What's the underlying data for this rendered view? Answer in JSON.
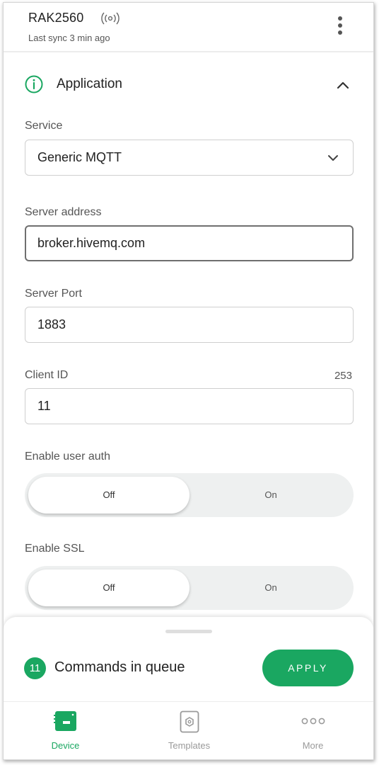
{
  "header": {
    "device_name": "RAK2560",
    "sync_status": "Last sync 3 min ago"
  },
  "section": {
    "title": "Application",
    "expanded": true
  },
  "fields": {
    "service": {
      "label": "Service",
      "value": "Generic MQTT"
    },
    "server_address": {
      "label": "Server address",
      "value": "broker.hivemq.com"
    },
    "server_port": {
      "label": "Server Port",
      "value": "1883"
    },
    "client_id": {
      "label": "Client ID",
      "value": "11",
      "counter": "253"
    }
  },
  "toggles": {
    "user_auth": {
      "label": "Enable user auth",
      "off_label": "Off",
      "on_label": "On",
      "selected": "Off"
    },
    "ssl": {
      "label": "Enable SSL",
      "off_label": "Off",
      "on_label": "On",
      "selected": "Off"
    }
  },
  "queue": {
    "count": "11",
    "text": "Commands in queue",
    "apply_label": "APPLY"
  },
  "nav": {
    "items": [
      {
        "label": "Device",
        "icon": "device-icon",
        "active": true
      },
      {
        "label": "Templates",
        "icon": "templates-icon",
        "active": false
      },
      {
        "label": "More",
        "icon": "more-icon",
        "active": false
      }
    ]
  },
  "colors": {
    "accent": "#1aa761",
    "text_primary": "#222222",
    "text_secondary": "#555555",
    "inactive_nav": "#9a9a9a"
  }
}
